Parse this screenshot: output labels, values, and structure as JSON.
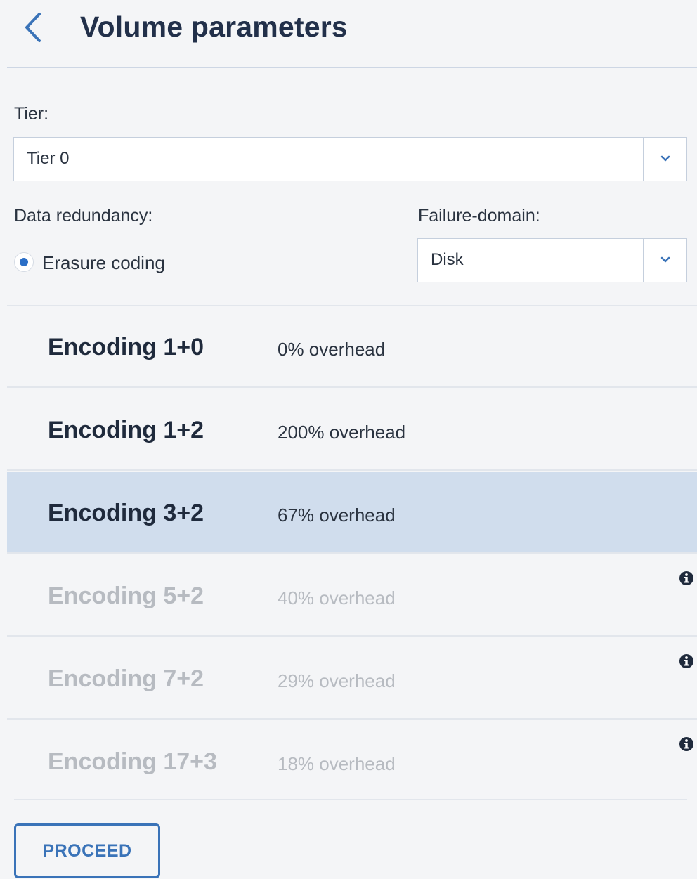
{
  "header": {
    "title": "Volume parameters",
    "back_icon": "chevron-left-icon"
  },
  "form": {
    "tier_label": "Tier:",
    "tier_value": "Tier 0",
    "redundancy_label": "Data redundancy:",
    "redundancy_option": "Erasure coding",
    "redundancy_selected": true,
    "failure_domain_label": "Failure-domain:",
    "failure_domain_value": "Disk"
  },
  "encodings": [
    {
      "name": "Encoding 1+0",
      "overhead": "0% overhead",
      "state": "enabled"
    },
    {
      "name": "Encoding 1+2",
      "overhead": "200% overhead",
      "state": "enabled"
    },
    {
      "name": "Encoding 3+2",
      "overhead": "67% overhead",
      "state": "selected"
    },
    {
      "name": "Encoding 5+2",
      "overhead": "40% overhead",
      "state": "disabled",
      "info_icon": "info-icon"
    },
    {
      "name": "Encoding 7+2",
      "overhead": "29% overhead",
      "state": "disabled",
      "info_icon": "info-icon"
    },
    {
      "name": "Encoding 17+3",
      "overhead": "18% overhead",
      "state": "disabled",
      "info_icon": "info-icon"
    }
  ],
  "footer": {
    "proceed_label": "PROCEED"
  },
  "colors": {
    "accent": "#3a73b8",
    "selected_row": "#d0dded",
    "background": "#f4f5f7",
    "disabled_text": "#b7bbc1"
  }
}
